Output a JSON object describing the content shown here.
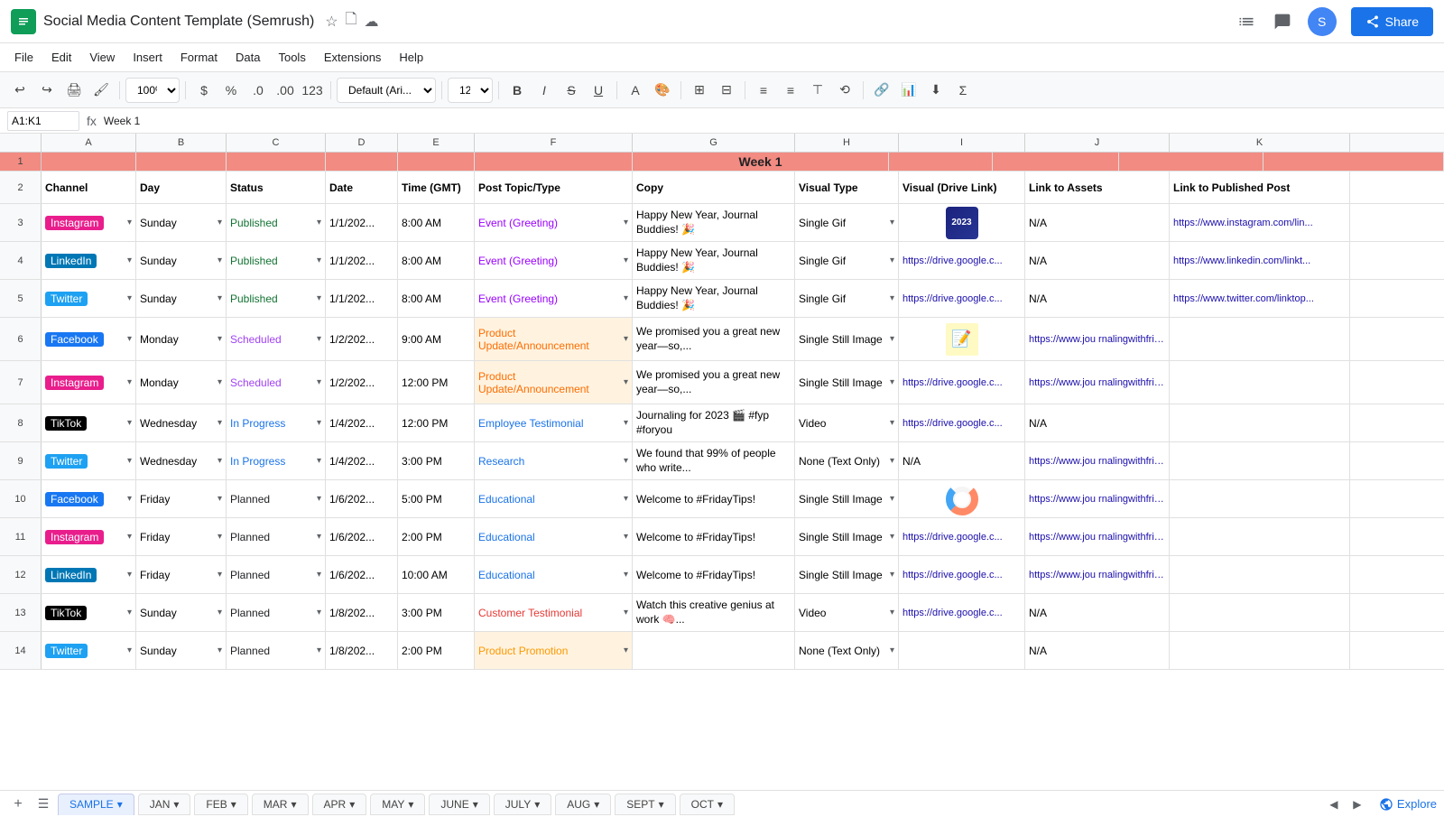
{
  "app": {
    "icon_color": "#0f9d58",
    "title": "Social Media Content Template (Semrush)",
    "menu_items": [
      "File",
      "Edit",
      "View",
      "Insert",
      "Format",
      "Data",
      "Tools",
      "Extensions",
      "Help"
    ],
    "share_label": "Share",
    "explore_label": "Explore"
  },
  "toolbar": {
    "zoom": "100%",
    "font": "Default (Ari...",
    "size": "12"
  },
  "formula_bar": {
    "cell_ref": "A1:K1",
    "formula_content": "Week 1"
  },
  "spreadsheet": {
    "week_label": "Week 1",
    "columns": [
      "A",
      "B",
      "C",
      "D",
      "E",
      "F",
      "G",
      "H",
      "I",
      "J",
      "K"
    ],
    "col_labels": [
      "",
      "",
      "",
      "",
      "",
      "",
      "",
      "",
      "",
      "",
      ""
    ],
    "headers": [
      "Channel",
      "Day",
      "Status",
      "Date",
      "Time (GMT)",
      "Post Topic/Type",
      "Copy",
      "Visual Type",
      "Visual (Drive Link)",
      "Link to Assets",
      "Link to Published Post"
    ],
    "rows": [
      {
        "row_num": "3",
        "channel": "Instagram",
        "channel_class": "ch-instagram",
        "day": "Sunday",
        "status": "Published",
        "status_class": "s-published",
        "date": "1/1/202...",
        "time": "8:00 AM",
        "post_type": "Event (Greeting)",
        "post_type_class": "pt-event",
        "copy": "Happy New Year, Journal Buddies! 🎉",
        "visual_type": "Single Gif",
        "visual_link": "",
        "visual_thumb": "2023",
        "link_assets": "N/A",
        "link_published": "https://www.instagram.com/lin..."
      },
      {
        "row_num": "4",
        "channel": "LinkedIn",
        "channel_class": "ch-linkedin",
        "day": "Sunday",
        "status": "Published",
        "status_class": "s-published",
        "date": "1/1/202...",
        "time": "8:00 AM",
        "post_type": "Event (Greeting)",
        "post_type_class": "pt-event",
        "copy": "Happy New Year, Journal Buddies! 🎉",
        "visual_type": "Single Gif",
        "visual_link": "https://drive.google.c...",
        "visual_thumb": "",
        "link_assets": "N/A",
        "link_published": "https://www.linkedin.com/linkt..."
      },
      {
        "row_num": "5",
        "channel": "Twitter",
        "channel_class": "ch-twitter",
        "day": "Sunday",
        "status": "Published",
        "status_class": "s-published",
        "date": "1/1/202...",
        "time": "8:00 AM",
        "post_type": "Event (Greeting)",
        "post_type_class": "pt-event",
        "copy": "Happy New Year, Journal Buddies! 🎉",
        "visual_type": "Single Gif",
        "visual_link": "https://drive.google.c...",
        "visual_thumb": "",
        "link_assets": "N/A",
        "link_published": "https://www.twitter.com/linktop..."
      },
      {
        "row_num": "6",
        "channel": "Facebook",
        "channel_class": "ch-facebook",
        "day": "Monday",
        "status": "Scheduled",
        "status_class": "s-scheduled",
        "date": "1/2/202...",
        "time": "9:00 AM",
        "post_type": "Product Update/Announcement",
        "post_type_class": "pt-product",
        "copy": "We promised you a great new year—so,...",
        "visual_type": "Single Still Image",
        "visual_link": "",
        "visual_thumb": "sticky",
        "link_assets": "https://www.jou rnalingwithfrien...",
        "link_published": ""
      },
      {
        "row_num": "7",
        "channel": "Instagram",
        "channel_class": "ch-instagram",
        "day": "Monday",
        "status": "Scheduled",
        "status_class": "s-scheduled",
        "date": "1/2/202...",
        "time": "12:00 PM",
        "post_type": "Product Update/Announcement",
        "post_type_class": "pt-product",
        "copy": "We promised you a great new year—so,...",
        "visual_type": "Single Still Image",
        "visual_link": "https://drive.google.c...",
        "visual_thumb": "",
        "link_assets": "https://www.jou rnalingwithfrien...",
        "link_published": ""
      },
      {
        "row_num": "8",
        "channel": "TikTok",
        "channel_class": "ch-tiktok",
        "day": "Wednesday",
        "status": "In Progress",
        "status_class": "s-inprogress",
        "date": "1/4/202...",
        "time": "12:00 PM",
        "post_type": "Employee Testimonial",
        "post_type_class": "pt-employee",
        "copy": "Journaling for 2023 🎬 #fyp #foryou",
        "visual_type": "Video",
        "visual_link": "https://drive.google.c...",
        "visual_thumb": "",
        "link_assets": "N/A",
        "link_published": ""
      },
      {
        "row_num": "9",
        "channel": "Twitter",
        "channel_class": "ch-twitter",
        "day": "Wednesday",
        "status": "In Progress",
        "status_class": "s-inprogress",
        "date": "1/4/202...",
        "time": "3:00 PM",
        "post_type": "Research",
        "post_type_class": "pt-research",
        "copy": "We found that 99% of people who write...",
        "visual_type": "None (Text Only)",
        "visual_link": "",
        "visual_thumb": "",
        "link_assets": "N/A",
        "link_published": "https://www.jou rnalingwithfrien ds.com/..."
      },
      {
        "row_num": "10",
        "channel": "Facebook",
        "channel_class": "ch-facebook",
        "day": "Friday",
        "status": "Planned",
        "status_class": "s-planned",
        "date": "1/6/202...",
        "time": "5:00 PM",
        "post_type": "Educational",
        "post_type_class": "pt-educational",
        "copy": "Welcome to #FridayTips!",
        "visual_type": "Single Still Image",
        "visual_link": "",
        "visual_thumb": "donut",
        "link_assets": "https://www.jou rnalingwithfrien ds.com/blog/di...",
        "link_published": ""
      },
      {
        "row_num": "11",
        "channel": "Instagram",
        "channel_class": "ch-instagram",
        "day": "Friday",
        "status": "Planned",
        "status_class": "s-planned",
        "date": "1/6/202...",
        "time": "2:00 PM",
        "post_type": "Educational",
        "post_type_class": "pt-educational",
        "copy": "Welcome to #FridayTips!",
        "visual_type": "Single Still Image",
        "visual_link": "https://drive.google.c...",
        "visual_thumb": "",
        "link_assets": "https://www.jou rnalingwithfrien...",
        "link_published": ""
      },
      {
        "row_num": "12",
        "channel": "LinkedIn",
        "channel_class": "ch-linkedin",
        "day": "Friday",
        "status": "Planned",
        "status_class": "s-planned",
        "date": "1/6/202...",
        "time": "10:00 AM",
        "post_type": "Educational",
        "post_type_class": "pt-educational",
        "copy": "Welcome to #FridayTips!",
        "visual_type": "Single Still Image",
        "visual_link": "https://drive.google.c...",
        "visual_thumb": "",
        "link_assets": "https://www.jou rnalingwithfrien...",
        "link_published": ""
      },
      {
        "row_num": "13",
        "channel": "TikTok",
        "channel_class": "ch-tiktok",
        "day": "Sunday",
        "status": "Planned",
        "status_class": "s-planned",
        "date": "1/8/202...",
        "time": "3:00 PM",
        "post_type": "Customer Testimonial",
        "post_type_class": "pt-customer",
        "copy": "Watch this creative genius at work 🧠...",
        "visual_type": "Video",
        "visual_link": "https://drive.google.c...",
        "visual_thumb": "",
        "link_assets": "N/A",
        "link_published": ""
      },
      {
        "row_num": "14",
        "channel": "Twitter",
        "channel_class": "ch-twitter",
        "day": "Sunday",
        "status": "Planned",
        "status_class": "s-planned",
        "date": "1/8/202...",
        "time": "2:00 PM",
        "post_type": "Product Promotion",
        "post_type_class": "pt-product-promo",
        "copy": "",
        "visual_type": "None (Text Only)",
        "visual_link": "",
        "visual_thumb": "",
        "link_assets": "N/A",
        "link_published": ""
      }
    ]
  },
  "tabs": {
    "active": "SAMPLE",
    "sheets": [
      "SAMPLE",
      "JAN",
      "FEB",
      "MAR",
      "APR",
      "MAY",
      "JUNE",
      "JULY",
      "AUG",
      "SEPT",
      "OCT"
    ]
  }
}
